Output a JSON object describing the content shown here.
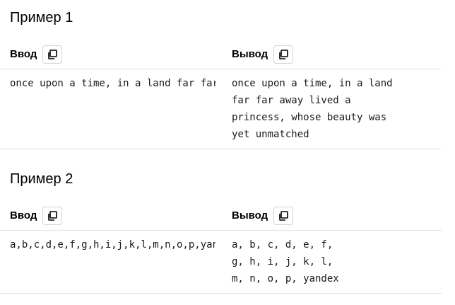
{
  "examples": [
    {
      "title": "Пример 1",
      "input_label": "Ввод",
      "output_label": "Вывод",
      "input_text": "once upon a time, in a land far far away lived a princess, whose beauty was yet unmatched",
      "output_text": "once upon a time, in a land\nfar far away lived a\nprincess, whose beauty was\nyet unmatched"
    },
    {
      "title": "Пример 2",
      "input_label": "Ввод",
      "output_label": "Вывод",
      "input_text": "a,b,c,d,e,f,g,h,i,j,k,l,m,n,o,p,yandex",
      "output_text": "a, b, c, d, e, f,\ng, h, i, j, k, l,\nm, n, o, p, yandex"
    }
  ],
  "icons": {
    "copy": "copy-icon"
  },
  "colors": {
    "divider": "#e3e3e3",
    "button_border": "#d4d4d4",
    "text": "#000000"
  }
}
